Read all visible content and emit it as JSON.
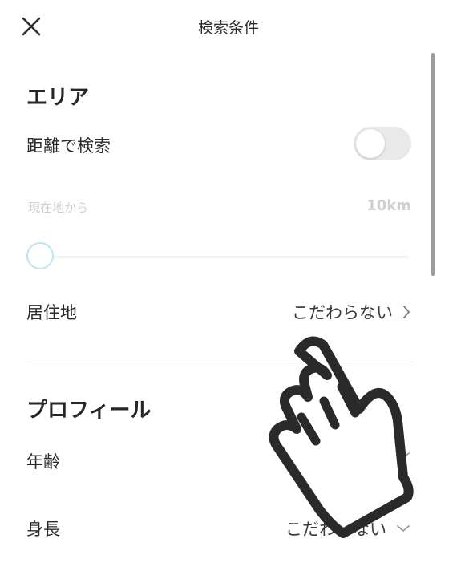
{
  "header": {
    "title": "検索条件",
    "close_icon": "close-icon"
  },
  "area": {
    "section_title": "エリア",
    "distance_search": {
      "label": "距離で検索",
      "enabled": false
    },
    "current_location": {
      "label": "現在地から",
      "value": "10km",
      "slider_value_fraction": 0
    },
    "residence": {
      "label": "居住地",
      "value": "こだわらない",
      "icon": "chevron-right-icon"
    }
  },
  "profile": {
    "section_title": "プロフィール",
    "age": {
      "label": "年齢",
      "icon": "chevron-down-icon"
    },
    "height": {
      "label": "身長",
      "value": "こだわらない",
      "icon": "chevron-down-icon"
    }
  },
  "overlay": {
    "icon": "pointing-hand-icon"
  },
  "colors": {
    "text": "#2b2b2b",
    "muted": "#cfcfcf",
    "toggle_off": "#e9e9e9",
    "slider_thumb_border": "#bfe3f2"
  }
}
